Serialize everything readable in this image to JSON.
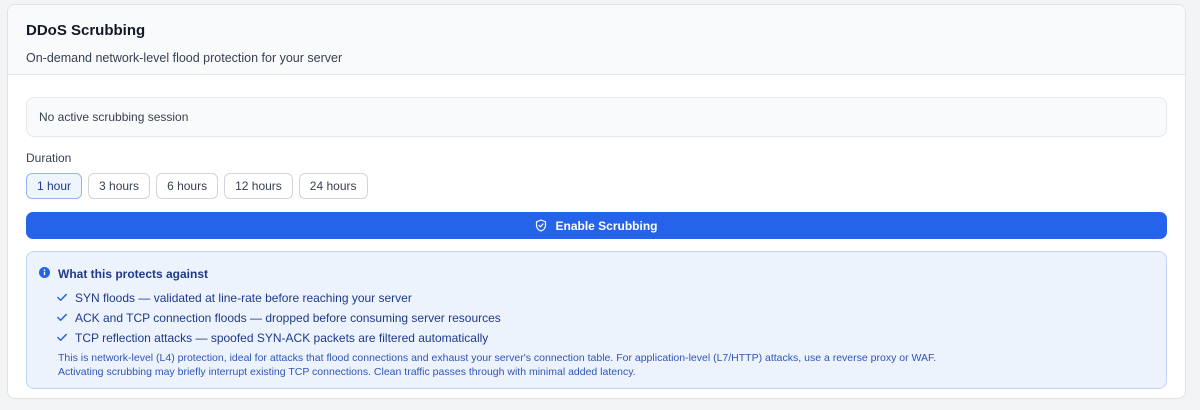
{
  "header": {
    "title": "DDoS Scrubbing",
    "subtitle": "On-demand network-level flood protection for your server"
  },
  "status": {
    "text": "No active scrubbing session"
  },
  "duration": {
    "label": "Duration",
    "options": [
      "1 hour",
      "3 hours",
      "6 hours",
      "12 hours",
      "24 hours"
    ],
    "selected": "1 hour"
  },
  "action": {
    "enable_label": "Enable Scrubbing",
    "icon": "shield-check-icon"
  },
  "info": {
    "icon": "info-icon",
    "title": "What this protects against",
    "items": [
      "SYN floods — validated at line-rate before reaching your server",
      "ACK and TCP connection floods — dropped before consuming server resources",
      "TCP reflection attacks — spoofed SYN-ACK packets are filtered automatically"
    ],
    "note_line1": "This is network-level (L4) protection, ideal for attacks that flood connections and exhaust your server's connection table. For application-level (L7/HTTP) attacks, use a reverse proxy or WAF.",
    "note_line2": "Activating scrubbing may briefly interrupt existing TCP connections. Clean traffic passes through with minimal added latency."
  },
  "colors": {
    "accent": "#2563eb",
    "info_bg": "#edf3fd",
    "info_text": "#1e3a8a"
  }
}
